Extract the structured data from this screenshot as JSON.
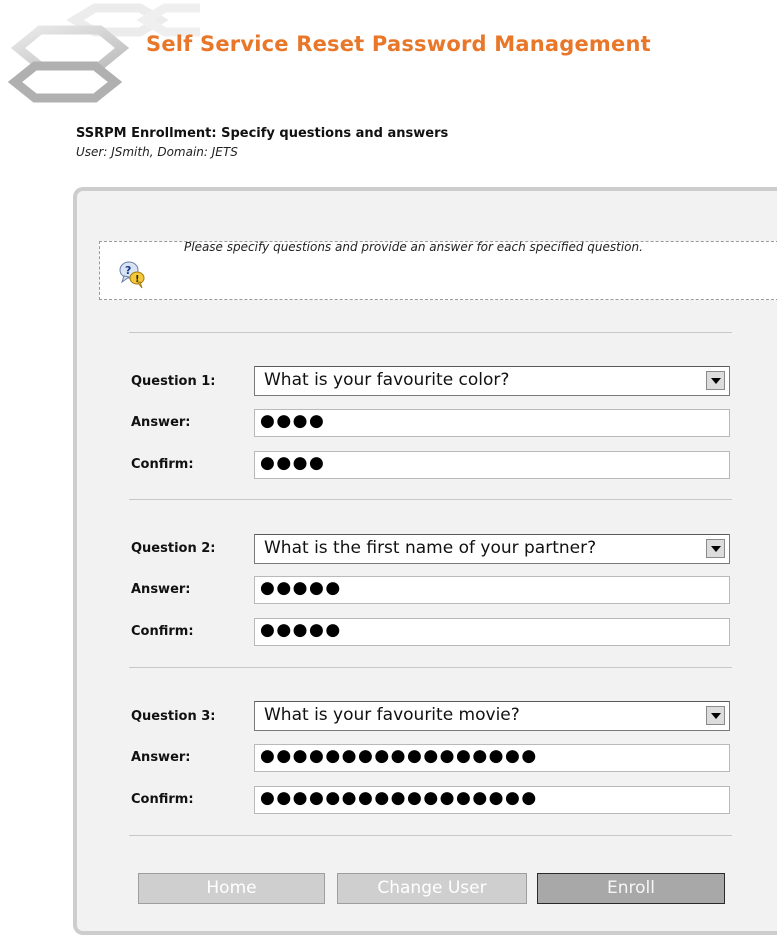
{
  "header": {
    "brand_title": "Self Service Reset Password Management"
  },
  "page": {
    "title": "SSRPM Enrollment: Specify questions and answers",
    "user_line": "User: JSmith, Domain: JETS"
  },
  "info": {
    "icon": "help-bubble-icon",
    "text": "Please specify questions and provide an answer for each specified question."
  },
  "questions": [
    {
      "label": "Question 1:",
      "selected": "What is your favourite color?",
      "answer_label": "Answer:",
      "answer_mask": "●●●●",
      "confirm_label": "Confirm:",
      "confirm_mask": "●●●●"
    },
    {
      "label": "Question 2:",
      "selected": "What is the first name of your partner?",
      "answer_label": "Answer:",
      "answer_mask": "●●●●●",
      "confirm_label": "Confirm:",
      "confirm_mask": "●●●●●"
    },
    {
      "label": "Question 3:",
      "selected": "What is your favourite movie?",
      "answer_label": "Answer:",
      "answer_mask": "●●●●●●●●●●●●●●●●●",
      "confirm_label": "Confirm:",
      "confirm_mask": "●●●●●●●●●●●●●●●●●"
    }
  ],
  "buttons": {
    "home": "Home",
    "change_user": "Change User",
    "enroll": "Enroll"
  },
  "colors": {
    "brand": "#e8772a",
    "panel_bg": "#f2f2f2",
    "panel_border": "#cdcdcd"
  }
}
